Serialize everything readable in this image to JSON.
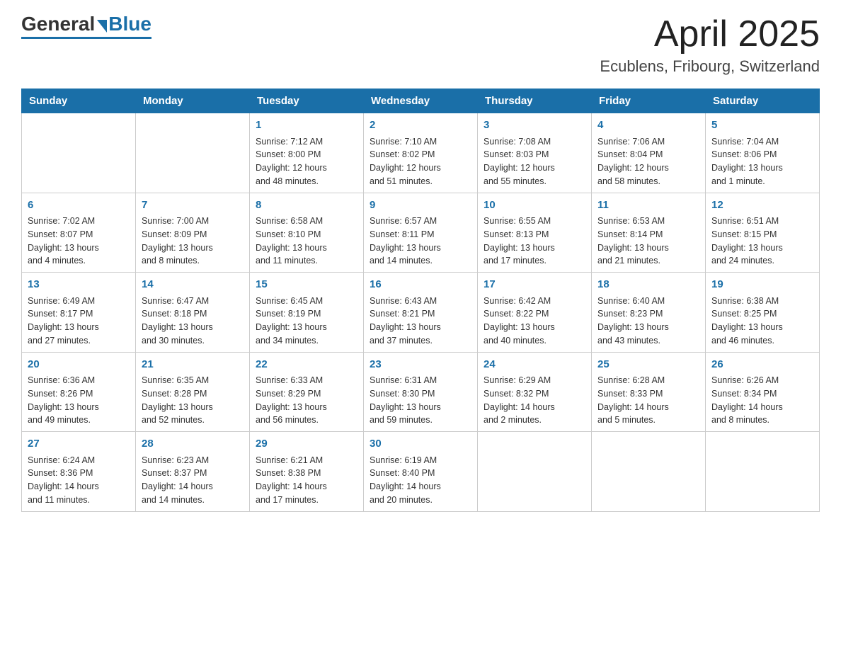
{
  "header": {
    "logo_text_general": "General",
    "logo_text_blue": "Blue",
    "month_title": "April 2025",
    "location": "Ecublens, Fribourg, Switzerland"
  },
  "weekdays": [
    "Sunday",
    "Monday",
    "Tuesday",
    "Wednesday",
    "Thursday",
    "Friday",
    "Saturday"
  ],
  "weeks": [
    [
      {
        "day": "",
        "sunrise": "",
        "sunset": "",
        "daylight1": "",
        "daylight2": ""
      },
      {
        "day": "",
        "sunrise": "",
        "sunset": "",
        "daylight1": "",
        "daylight2": ""
      },
      {
        "day": "1",
        "sunrise": "Sunrise: 7:12 AM",
        "sunset": "Sunset: 8:00 PM",
        "daylight1": "Daylight: 12 hours",
        "daylight2": "and 48 minutes."
      },
      {
        "day": "2",
        "sunrise": "Sunrise: 7:10 AM",
        "sunset": "Sunset: 8:02 PM",
        "daylight1": "Daylight: 12 hours",
        "daylight2": "and 51 minutes."
      },
      {
        "day": "3",
        "sunrise": "Sunrise: 7:08 AM",
        "sunset": "Sunset: 8:03 PM",
        "daylight1": "Daylight: 12 hours",
        "daylight2": "and 55 minutes."
      },
      {
        "day": "4",
        "sunrise": "Sunrise: 7:06 AM",
        "sunset": "Sunset: 8:04 PM",
        "daylight1": "Daylight: 12 hours",
        "daylight2": "and 58 minutes."
      },
      {
        "day": "5",
        "sunrise": "Sunrise: 7:04 AM",
        "sunset": "Sunset: 8:06 PM",
        "daylight1": "Daylight: 13 hours",
        "daylight2": "and 1 minute."
      }
    ],
    [
      {
        "day": "6",
        "sunrise": "Sunrise: 7:02 AM",
        "sunset": "Sunset: 8:07 PM",
        "daylight1": "Daylight: 13 hours",
        "daylight2": "and 4 minutes."
      },
      {
        "day": "7",
        "sunrise": "Sunrise: 7:00 AM",
        "sunset": "Sunset: 8:09 PM",
        "daylight1": "Daylight: 13 hours",
        "daylight2": "and 8 minutes."
      },
      {
        "day": "8",
        "sunrise": "Sunrise: 6:58 AM",
        "sunset": "Sunset: 8:10 PM",
        "daylight1": "Daylight: 13 hours",
        "daylight2": "and 11 minutes."
      },
      {
        "day": "9",
        "sunrise": "Sunrise: 6:57 AM",
        "sunset": "Sunset: 8:11 PM",
        "daylight1": "Daylight: 13 hours",
        "daylight2": "and 14 minutes."
      },
      {
        "day": "10",
        "sunrise": "Sunrise: 6:55 AM",
        "sunset": "Sunset: 8:13 PM",
        "daylight1": "Daylight: 13 hours",
        "daylight2": "and 17 minutes."
      },
      {
        "day": "11",
        "sunrise": "Sunrise: 6:53 AM",
        "sunset": "Sunset: 8:14 PM",
        "daylight1": "Daylight: 13 hours",
        "daylight2": "and 21 minutes."
      },
      {
        "day": "12",
        "sunrise": "Sunrise: 6:51 AM",
        "sunset": "Sunset: 8:15 PM",
        "daylight1": "Daylight: 13 hours",
        "daylight2": "and 24 minutes."
      }
    ],
    [
      {
        "day": "13",
        "sunrise": "Sunrise: 6:49 AM",
        "sunset": "Sunset: 8:17 PM",
        "daylight1": "Daylight: 13 hours",
        "daylight2": "and 27 minutes."
      },
      {
        "day": "14",
        "sunrise": "Sunrise: 6:47 AM",
        "sunset": "Sunset: 8:18 PM",
        "daylight1": "Daylight: 13 hours",
        "daylight2": "and 30 minutes."
      },
      {
        "day": "15",
        "sunrise": "Sunrise: 6:45 AM",
        "sunset": "Sunset: 8:19 PM",
        "daylight1": "Daylight: 13 hours",
        "daylight2": "and 34 minutes."
      },
      {
        "day": "16",
        "sunrise": "Sunrise: 6:43 AM",
        "sunset": "Sunset: 8:21 PM",
        "daylight1": "Daylight: 13 hours",
        "daylight2": "and 37 minutes."
      },
      {
        "day": "17",
        "sunrise": "Sunrise: 6:42 AM",
        "sunset": "Sunset: 8:22 PM",
        "daylight1": "Daylight: 13 hours",
        "daylight2": "and 40 minutes."
      },
      {
        "day": "18",
        "sunrise": "Sunrise: 6:40 AM",
        "sunset": "Sunset: 8:23 PM",
        "daylight1": "Daylight: 13 hours",
        "daylight2": "and 43 minutes."
      },
      {
        "day": "19",
        "sunrise": "Sunrise: 6:38 AM",
        "sunset": "Sunset: 8:25 PM",
        "daylight1": "Daylight: 13 hours",
        "daylight2": "and 46 minutes."
      }
    ],
    [
      {
        "day": "20",
        "sunrise": "Sunrise: 6:36 AM",
        "sunset": "Sunset: 8:26 PM",
        "daylight1": "Daylight: 13 hours",
        "daylight2": "and 49 minutes."
      },
      {
        "day": "21",
        "sunrise": "Sunrise: 6:35 AM",
        "sunset": "Sunset: 8:28 PM",
        "daylight1": "Daylight: 13 hours",
        "daylight2": "and 52 minutes."
      },
      {
        "day": "22",
        "sunrise": "Sunrise: 6:33 AM",
        "sunset": "Sunset: 8:29 PM",
        "daylight1": "Daylight: 13 hours",
        "daylight2": "and 56 minutes."
      },
      {
        "day": "23",
        "sunrise": "Sunrise: 6:31 AM",
        "sunset": "Sunset: 8:30 PM",
        "daylight1": "Daylight: 13 hours",
        "daylight2": "and 59 minutes."
      },
      {
        "day": "24",
        "sunrise": "Sunrise: 6:29 AM",
        "sunset": "Sunset: 8:32 PM",
        "daylight1": "Daylight: 14 hours",
        "daylight2": "and 2 minutes."
      },
      {
        "day": "25",
        "sunrise": "Sunrise: 6:28 AM",
        "sunset": "Sunset: 8:33 PM",
        "daylight1": "Daylight: 14 hours",
        "daylight2": "and 5 minutes."
      },
      {
        "day": "26",
        "sunrise": "Sunrise: 6:26 AM",
        "sunset": "Sunset: 8:34 PM",
        "daylight1": "Daylight: 14 hours",
        "daylight2": "and 8 minutes."
      }
    ],
    [
      {
        "day": "27",
        "sunrise": "Sunrise: 6:24 AM",
        "sunset": "Sunset: 8:36 PM",
        "daylight1": "Daylight: 14 hours",
        "daylight2": "and 11 minutes."
      },
      {
        "day": "28",
        "sunrise": "Sunrise: 6:23 AM",
        "sunset": "Sunset: 8:37 PM",
        "daylight1": "Daylight: 14 hours",
        "daylight2": "and 14 minutes."
      },
      {
        "day": "29",
        "sunrise": "Sunrise: 6:21 AM",
        "sunset": "Sunset: 8:38 PM",
        "daylight1": "Daylight: 14 hours",
        "daylight2": "and 17 minutes."
      },
      {
        "day": "30",
        "sunrise": "Sunrise: 6:19 AM",
        "sunset": "Sunset: 8:40 PM",
        "daylight1": "Daylight: 14 hours",
        "daylight2": "and 20 minutes."
      },
      {
        "day": "",
        "sunrise": "",
        "sunset": "",
        "daylight1": "",
        "daylight2": ""
      },
      {
        "day": "",
        "sunrise": "",
        "sunset": "",
        "daylight1": "",
        "daylight2": ""
      },
      {
        "day": "",
        "sunrise": "",
        "sunset": "",
        "daylight1": "",
        "daylight2": ""
      }
    ]
  ]
}
